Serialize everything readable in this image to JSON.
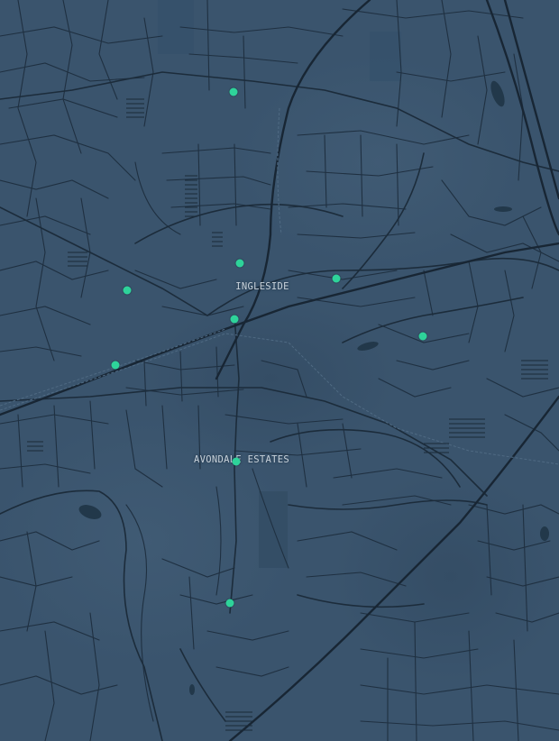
{
  "map": {
    "colors": {
      "background": "#3a546d",
      "roads": "#1f3041",
      "major_roads": "#1a2937",
      "water": "#22384a",
      "marker": "#2ed39a"
    },
    "labels": {
      "ingleside": "INGLESIDE",
      "avondale_estates": "AVONDALE ESTATES"
    },
    "marker_count": 9,
    "icons": {
      "marker": "map-pin-dot-icon"
    }
  }
}
